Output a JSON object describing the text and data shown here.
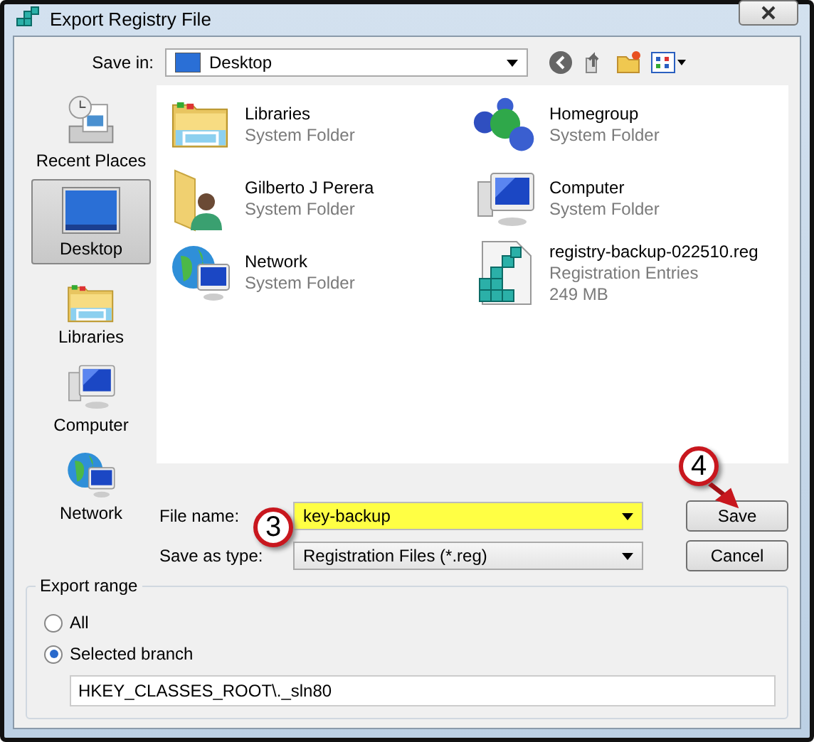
{
  "window": {
    "title": "Export Registry File"
  },
  "save_in": {
    "label": "Save in:",
    "value": "Desktop"
  },
  "places": [
    {
      "kind": "recent",
      "label": "Recent Places",
      "selected": false
    },
    {
      "kind": "desktop",
      "label": "Desktop",
      "selected": true
    },
    {
      "kind": "libraries",
      "label": "Libraries",
      "selected": false
    },
    {
      "kind": "computer",
      "label": "Computer",
      "selected": false
    },
    {
      "kind": "network",
      "label": "Network",
      "selected": false
    }
  ],
  "files": [
    {
      "kind": "libraries",
      "name": "Libraries",
      "type": "System Folder"
    },
    {
      "kind": "homegroup",
      "name": "Homegroup",
      "type": "System Folder"
    },
    {
      "kind": "user",
      "name": "Gilberto J Perera",
      "type": "System Folder"
    },
    {
      "kind": "computer",
      "name": "Computer",
      "type": "System Folder"
    },
    {
      "kind": "network",
      "name": "Network",
      "type": "System Folder"
    },
    {
      "kind": "reg",
      "name": "registry-backup-022510.reg",
      "type": "Registration Entries",
      "size": "249 MB"
    }
  ],
  "file_name": {
    "label": "File name:",
    "value": "key-backup",
    "highlighted": true
  },
  "save_as_type": {
    "label": "Save as type:",
    "value": "Registration Files (*.reg)"
  },
  "buttons": [
    {
      "label": "Save"
    },
    {
      "label": "Cancel"
    }
  ],
  "export_range": {
    "title": "Export range",
    "options": [
      {
        "label": "All",
        "selected": false
      },
      {
        "label": "Selected branch",
        "selected": true
      }
    ],
    "branch": "HKEY_CLASSES_ROOT\\._sln80"
  },
  "annotations": [
    {
      "text": "3"
    },
    {
      "text": "4"
    }
  ]
}
